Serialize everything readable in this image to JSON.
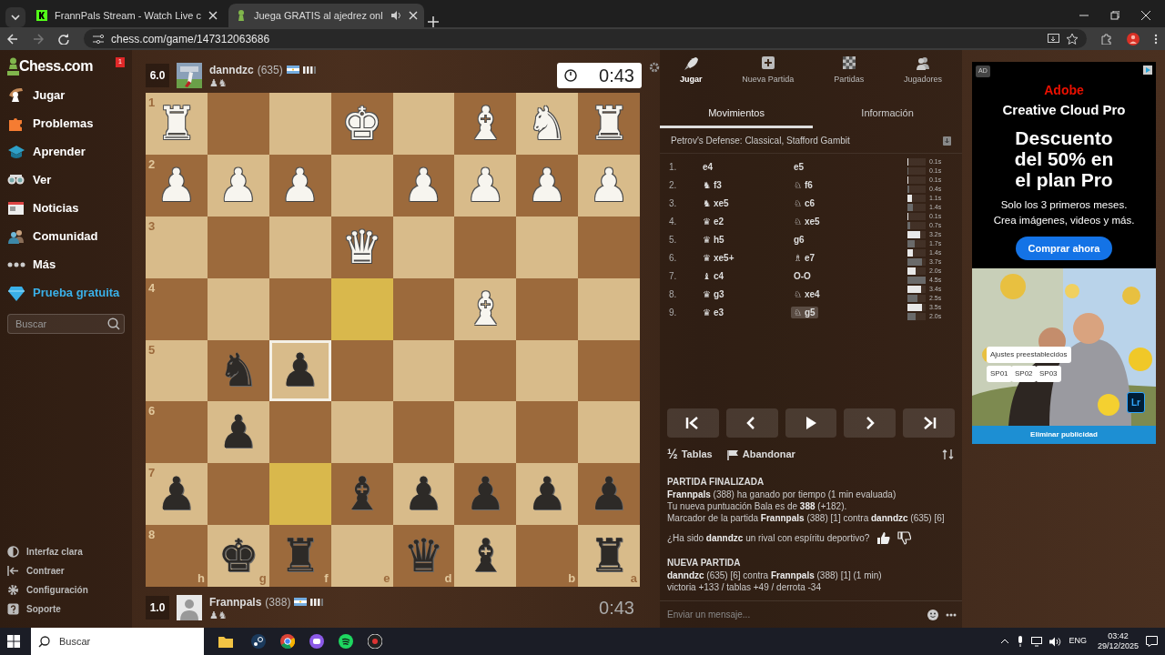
{
  "browser": {
    "tabs": [
      {
        "title": "FrannPals Stream - Watch Live c",
        "selected": false
      },
      {
        "title": "Juega GRATIS al ajedrez onl",
        "selected": true
      }
    ],
    "url": "chess.com/game/147312063686"
  },
  "sidebar": {
    "logo": "Chess.com",
    "badge": "1",
    "items": [
      {
        "label": "Jugar",
        "kind": "nav"
      },
      {
        "label": "Problemas",
        "kind": "nav"
      },
      {
        "label": "Aprender",
        "kind": "nav"
      },
      {
        "label": "Ver",
        "kind": "nav"
      },
      {
        "label": "Noticias",
        "kind": "nav"
      },
      {
        "label": "Comunidad",
        "kind": "nav"
      },
      {
        "label": "Más",
        "kind": "nav"
      },
      {
        "label": "Prueba gratuita",
        "kind": "promo"
      }
    ],
    "search": {
      "placeholder": "Buscar"
    },
    "footer": [
      "Interfaz clara",
      "Contraer",
      "Configuración",
      "Soporte"
    ]
  },
  "players": [
    {
      "score": "6.0",
      "name": "danndzc",
      "rating": "(635)",
      "captured": "♟♞",
      "clock": "0:43",
      "active": true
    },
    {
      "score": "1.0",
      "name": "Frannpals",
      "rating": "(388)",
      "captured": "♟♞",
      "clock": "0:43",
      "active": false
    }
  ],
  "board": {
    "rows": [
      [
        {
          "rank": "1",
          "glyph": "♜",
          "white": true
        },
        {},
        {},
        {
          "glyph": "♚",
          "white": true
        },
        {},
        {
          "glyph": "♝",
          "white": true
        },
        {
          "glyph": "♞",
          "white": true
        },
        {
          "glyph": "♜",
          "white": true
        }
      ],
      [
        {
          "rank": "2",
          "glyph": "♟",
          "white": true
        },
        {
          "glyph": "♟",
          "white": true
        },
        {
          "glyph": "♟",
          "white": true
        },
        {},
        {
          "glyph": "♟",
          "white": true
        },
        {
          "glyph": "♟",
          "white": true
        },
        {
          "glyph": "♟",
          "white": true
        },
        {
          "glyph": "♟",
          "white": true
        }
      ],
      [
        {
          "rank": "3"
        },
        {},
        {},
        {
          "glyph": "♛",
          "white": true
        },
        {},
        {},
        {},
        {}
      ],
      [
        {
          "rank": "4"
        },
        {},
        {},
        {
          "highlighted": true
        },
        {},
        {
          "glyph": "♝",
          "white": true
        },
        {},
        {}
      ],
      [
        {
          "rank": "5"
        },
        {
          "glyph": "♞",
          "white": false
        },
        {
          "glyph": "♟",
          "white": false,
          "hovered": true
        },
        {},
        {},
        {},
        {},
        {}
      ],
      [
        {
          "rank": "6"
        },
        {
          "glyph": "♟",
          "white": false
        },
        {},
        {},
        {},
        {},
        {},
        {}
      ],
      [
        {
          "rank": "7",
          "glyph": "♟",
          "white": false
        },
        {},
        {
          "highlighted": true
        },
        {
          "glyph": "♝",
          "white": false
        },
        {
          "glyph": "♟",
          "white": false
        },
        {
          "glyph": "♟",
          "white": false
        },
        {
          "glyph": "♟",
          "white": false
        },
        {
          "glyph": "♟",
          "white": false
        }
      ],
      [
        {
          "rank": "8",
          "file": "h"
        },
        {
          "file": "g",
          "glyph": "♚",
          "white": false
        },
        {
          "file": "f",
          "glyph": "♜",
          "white": false
        },
        {
          "file": "e"
        },
        {
          "file": "d",
          "glyph": "♛",
          "white": false
        },
        {
          "glyph": "♝",
          "white": false
        },
        {
          "file": "b"
        },
        {
          "file": "a",
          "glyph": "♜",
          "white": false
        }
      ]
    ]
  },
  "panel": {
    "nav": [
      {
        "label": "Jugar",
        "selected": true
      },
      {
        "label": "Nueva Partida",
        "selected": false
      },
      {
        "label": "Partidas",
        "selected": false
      },
      {
        "label": "Jugadores",
        "selected": false
      }
    ],
    "tabs": [
      {
        "label": "Movimientos",
        "selected": true
      },
      {
        "label": "Información",
        "selected": false
      }
    ],
    "opening": "Petrov's Defense: Classical, Stafford Gambit",
    "moves": [
      {
        "number": "1.",
        "white": {
          "san": "e4",
          "selected": false
        },
        "black": {
          "san": "e5",
          "selected": false
        },
        "times": [
          {
            "text": "0.1s",
            "level": 0.02
          },
          {
            "text": "0.1s",
            "level": 0.02
          }
        ]
      },
      {
        "number": "2.",
        "white": {
          "figure": "♞",
          "san": "f3",
          "selected": false
        },
        "black": {
          "figure": "♘",
          "san": "f6",
          "selected": false
        },
        "times": [
          {
            "text": "0.1s",
            "level": 0.02
          },
          {
            "text": "0.4s",
            "level": 0.09
          }
        ]
      },
      {
        "number": "3.",
        "white": {
          "figure": "♞",
          "san": "xe5",
          "selected": false
        },
        "black": {
          "figure": "♘",
          "san": "c6",
          "selected": false
        },
        "times": [
          {
            "text": "1.1s",
            "level": 0.24
          },
          {
            "text": "1.4s",
            "level": 0.31
          }
        ]
      },
      {
        "number": "4.",
        "white": {
          "figure": "♛",
          "san": "e2",
          "selected": false
        },
        "black": {
          "figure": "♘",
          "san": "xe5",
          "selected": false
        },
        "times": [
          {
            "text": "0.1s",
            "level": 0.02
          },
          {
            "text": "0.7s",
            "level": 0.16
          }
        ]
      },
      {
        "number": "5.",
        "white": {
          "figure": "♛",
          "san": "h5",
          "selected": false
        },
        "black": {
          "san": "g6",
          "selected": false
        },
        "times": [
          {
            "text": "3.2s",
            "level": 0.71
          },
          {
            "text": "1.7s",
            "level": 0.38
          }
        ]
      },
      {
        "number": "6.",
        "white": {
          "figure": "♛",
          "san": "xe5+",
          "selected": false
        },
        "black": {
          "figure": "♗",
          "san": "e7",
          "selected": false
        },
        "times": [
          {
            "text": "1.4s",
            "level": 0.31
          },
          {
            "text": "3.7s",
            "level": 0.82
          }
        ]
      },
      {
        "number": "7.",
        "white": {
          "figure": "♝",
          "san": "c4",
          "selected": false
        },
        "black": {
          "san": "O-O",
          "selected": false
        },
        "times": [
          {
            "text": "2.0s",
            "level": 0.44
          },
          {
            "text": "4.5s",
            "level": 1
          }
        ]
      },
      {
        "number": "8.",
        "white": {
          "figure": "♛",
          "san": "g3",
          "selected": false
        },
        "black": {
          "figure": "♘",
          "san": "xe4",
          "selected": false
        },
        "times": [
          {
            "text": "3.4s",
            "level": 0.76
          },
          {
            "text": "2.5s",
            "level": 0.56
          }
        ]
      },
      {
        "number": "9.",
        "white": {
          "figure": "♛",
          "san": "e3",
          "selected": false
        },
        "black": {
          "figure": "♘",
          "san": "g5",
          "selected": true
        },
        "times": [
          {
            "text": "3.5s",
            "level": 0.78
          },
          {
            "text": "2.0s",
            "level": 0.44
          }
        ]
      }
    ],
    "controls": [
      {
        "kind": "first"
      },
      {
        "kind": "previous"
      },
      {
        "kind": "play"
      },
      {
        "kind": "next"
      },
      {
        "kind": "last"
      }
    ],
    "draw": {
      "symbol": "½",
      "label": "Tablas"
    },
    "resign": {
      "label": "Abandonar"
    },
    "messages": [
      {
        "kind": "heading",
        "text": "PARTIDA FINALIZADA"
      },
      {
        "kind": "text",
        "text": "**Frannpals** (388) ha ganado por tiempo (1 min evaluada)"
      },
      {
        "kind": "text",
        "text": "Tu nueva puntuación Bala es de **388** (+182)."
      },
      {
        "kind": "text",
        "text": "Marcador de la partida **Frannpals** (388) [1] contra **danndzc** (635) [6]"
      },
      {
        "kind": "question",
        "text": "¿Ha sido **danndzc** un rival con espíritu deportivo?"
      },
      {
        "kind": "heading",
        "text": "NUEVA PARTIDA"
      },
      {
        "kind": "text",
        "text": "**danndzc** (635) [6] contra **Frannpals** (388) [1] (1 min)"
      },
      {
        "kind": "text",
        "text": "victoria +133 / tablas +49 / derrota -34"
      }
    ],
    "chat": {
      "placeholder": "Enviar un mensaje..."
    }
  },
  "ad": {
    "tag": "AD",
    "brand": "Adobe",
    "product": "Creative Cloud Pro",
    "headline": "Descuento del 50% en el plan Pro",
    "lines": [
      "Solo los 3 primeros meses.",
      "Crea imágenes, videos y más."
    ],
    "button": "Comprar ahora",
    "chip": "Ajustes preestablecidos",
    "presets": [
      "SP01",
      "SP02",
      "SP03"
    ],
    "app": "Lr",
    "remove": "Eliminar publicidad"
  },
  "taskbar": {
    "search": {
      "placeholder": "Buscar"
    },
    "language": "ENG",
    "time": "03:42",
    "date": "29/12/2025"
  }
}
